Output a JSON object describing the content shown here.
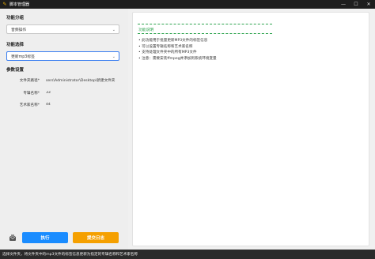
{
  "window": {
    "title": "脚本管理器",
    "controls": [
      "minimize-icon",
      "maximize-icon",
      "close-icon"
    ]
  },
  "sidebar": {
    "group_label": "功能分组",
    "group_value": "音频操作",
    "function_label": "功能选择",
    "function_value": "更新mp3标签",
    "params_label": "参数设置",
    "params": [
      {
        "label": "文件夹路径*",
        "value": "sers\\Administrator\\Desktop\\新建文件夹"
      },
      {
        "label": "专辑名称*",
        "value": "33"
      },
      {
        "label": "艺术家名称*",
        "value": "44"
      }
    ],
    "run_label": "执行",
    "submit_log_label": "提交日志",
    "accent_colors": {
      "run": "#1a8cff",
      "submit": "#f5a000",
      "title_green": "#2ea44f"
    }
  },
  "description": {
    "title": "功能说明",
    "items": [
      "此功能用于批量更新MP3文件的标签信息",
      "可以设置专辑名称和艺术家名称",
      "支持处理文件夹中的所有MP3文件",
      "注意：需要安装ffmpeg并添加到系统环境变量"
    ]
  },
  "statusbar": {
    "text": "选择文件夹，将文件夹中的mp3文件的标签信息更新为指定的专辑名称和艺术家名称"
  }
}
